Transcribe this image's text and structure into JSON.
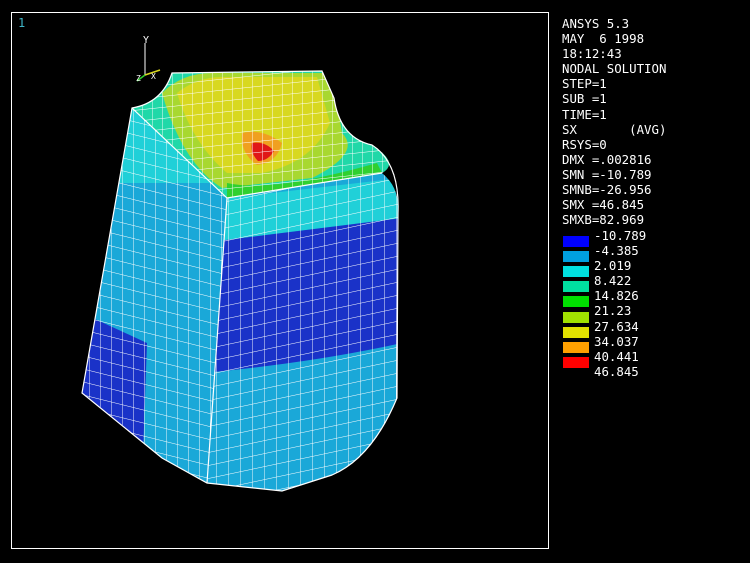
{
  "viewport": {
    "window_number": "1",
    "triad": {
      "y_label": "Y",
      "z_label": "Z",
      "x_label": "X"
    }
  },
  "info": {
    "lines": [
      "ANSYS 5.3",
      "MAY  6 1998",
      "18:12:43",
      "NODAL SOLUTION",
      "STEP=1",
      "SUB =1",
      "TIME=1",
      "SX       (AVG)",
      "RSYS=0",
      "DMX =.002816",
      "SMN =-10.789",
      "SMNB=-26.956",
      "SMX =46.845",
      "SMXB=82.969"
    ]
  },
  "legend": {
    "values": [
      "-10.789",
      "-4.385",
      "2.019",
      "8.422",
      "14.826",
      "21.23",
      "27.634",
      "34.037",
      "40.441",
      "46.845"
    ],
    "colors": [
      "#0000ff",
      "#00a0e0",
      "#00e0e0",
      "#00e0a0",
      "#00e000",
      "#a0e000",
      "#e0e000",
      "#ffa000",
      "#ff0000"
    ]
  },
  "colors": {
    "background": "#000000",
    "frame": "#ffffff",
    "mesh": "#ffffff",
    "window_number": "#3fb6c8",
    "blue": "#1a32c8",
    "light_blue": "#1aa8d8",
    "cyan": "#20d0d8",
    "teal": "#20d8a8",
    "green": "#30d030",
    "yellow_green": "#a8d830",
    "yellow": "#d8d820",
    "orange": "#f0a020",
    "red": "#e01818"
  }
}
